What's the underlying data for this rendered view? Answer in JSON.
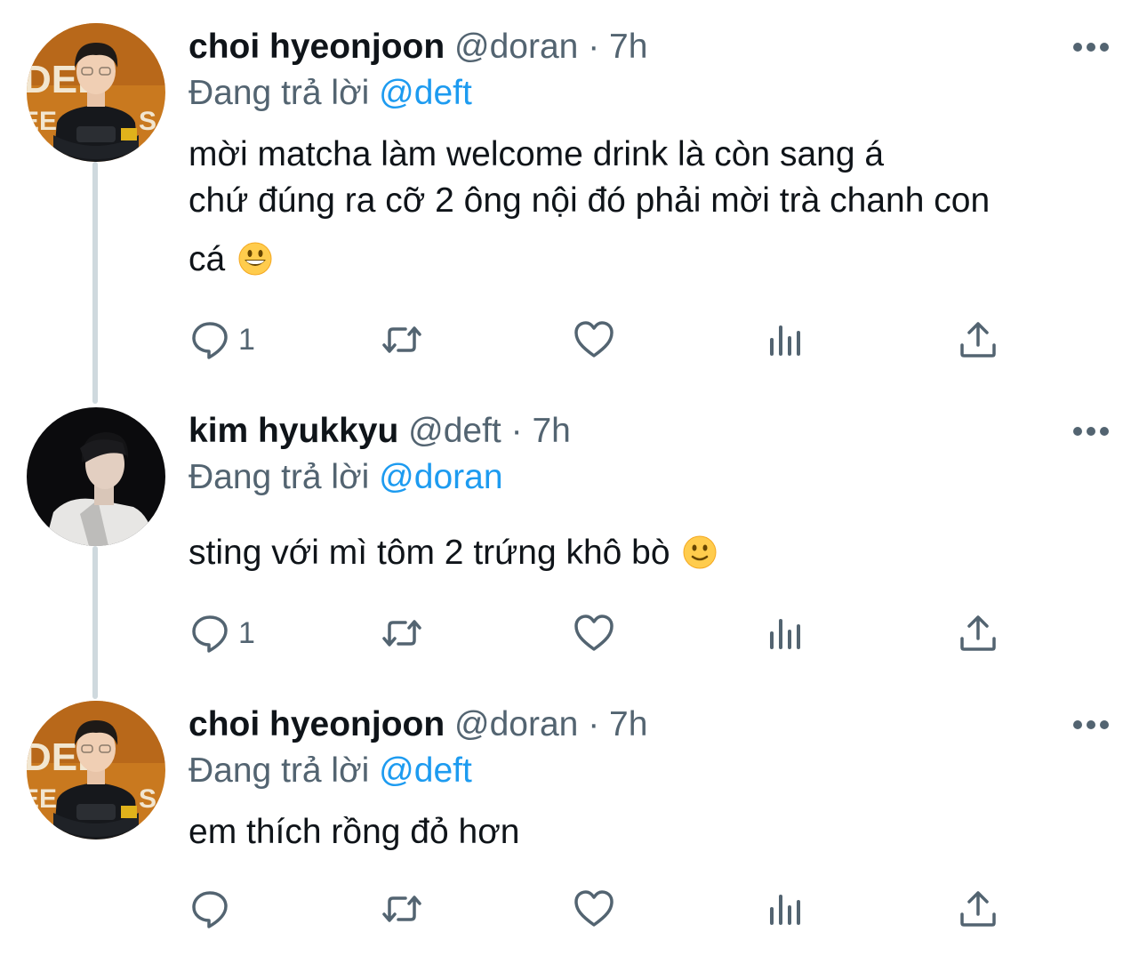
{
  "tweets": [
    {
      "name": "choi hyeonjoon",
      "handle": "@doran",
      "separator": "·",
      "time": "7h",
      "replying_to_label": "Đang trả lời",
      "replying_to": "@deft",
      "text_lines": [
        "mời matcha làm welcome drink là còn sang á",
        "chứ đúng ra cỡ 2 ông nội đó phải mời trà chanh con",
        "cá"
      ],
      "emoji": "grinning-face",
      "reply_count": "1"
    },
    {
      "name": "kim hyukkyu",
      "handle": "@deft",
      "separator": "·",
      "time": "7h",
      "replying_to_label": "Đang trả lời",
      "replying_to": "@doran",
      "text_lines": [
        "sting với mì tôm 2 trứng khô bò"
      ],
      "emoji": "slightly-smiling-face",
      "reply_count": "1"
    },
    {
      "name": "choi hyeonjoon",
      "handle": "@doran",
      "separator": "·",
      "time": "7h",
      "replying_to_label": "Đang trả lời",
      "replying_to": "@deft",
      "text_lines": [
        "em thích rồng đỏ hơn"
      ],
      "reply_count": ""
    }
  ],
  "icons": {
    "reply": "reply-icon",
    "retweet": "retweet-icon",
    "like": "like-icon",
    "views": "views-icon",
    "share": "share-icon",
    "more": "more-icon"
  },
  "colors": {
    "text": "#0f1419",
    "secondary": "#536471",
    "mention": "#1d9bf0",
    "thread_line": "#cfd9de"
  }
}
